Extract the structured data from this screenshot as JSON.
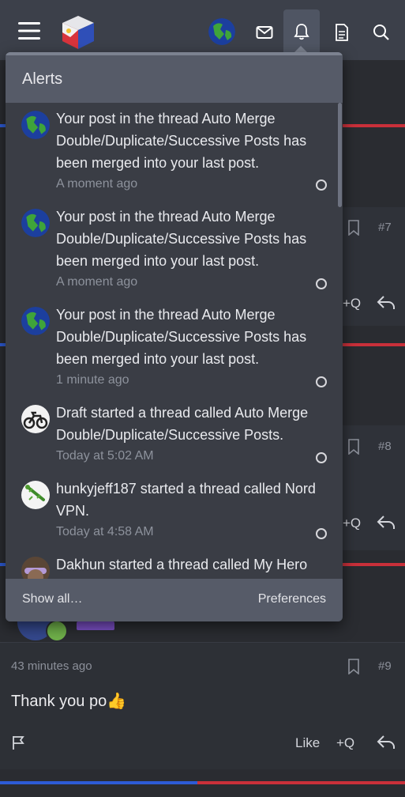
{
  "topbar": {
    "icons": [
      "menu-icon",
      "site-logo",
      "user-avatar",
      "mail-icon",
      "bell-icon",
      "document-icon",
      "search-icon"
    ]
  },
  "alerts": {
    "title": "Alerts",
    "items": [
      {
        "avatar": "globe-avatar",
        "text": "Your post in the thread Auto Merge Double/Duplicate/Successive Posts has been merged into your last post.",
        "time": "A moment ago"
      },
      {
        "avatar": "globe-avatar",
        "text": "Your post in the thread Auto Merge Double/Duplicate/Successive Posts has been merged into your last post.",
        "time": "A moment ago"
      },
      {
        "avatar": "globe-avatar",
        "text": "Your post in the thread Auto Merge Double/Duplicate/Successive Posts has been merged into your last post.",
        "time": "1 minute ago"
      },
      {
        "avatar": "motorbike-avatar",
        "text": "Draft started a thread called Auto Merge Double/Duplicate/Successive Posts.",
        "time": "Today at 5:02 AM"
      },
      {
        "avatar": "lizard-avatar",
        "text": "hunkyjeff187 started a thread called Nord VPN.",
        "time": "Today at 4:58 AM"
      },
      {
        "avatar": "hero-avatar",
        "text": "Dakhun started a thread called My Hero",
        "time": ""
      }
    ],
    "show_all": "Show all…",
    "preferences": "Preferences"
  },
  "thread": {
    "post7": {
      "num": "#7",
      "quote": "+Q"
    },
    "post8": {
      "num": "#8",
      "quote": "+Q"
    },
    "post9": {
      "num": "#9",
      "time": "43 minutes ago",
      "body": "Thank you po",
      "emoji": "👍",
      "like": "Like",
      "quote": "+Q"
    }
  },
  "colors": {
    "topbar": "#3c404a",
    "popup": "#3a3d45",
    "popup_header": "#565b68",
    "stripe_red": "#c9303a",
    "stripe_blue": "#2d5bd6"
  }
}
